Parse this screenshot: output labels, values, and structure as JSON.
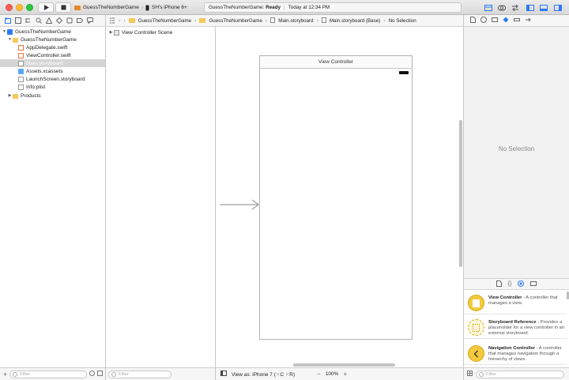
{
  "toolbar": {
    "run_icon": "play-icon",
    "stop_icon": "stop-icon",
    "scheme_name": "GuessTheNumberGame",
    "device_name": "SH's iPhone 6+",
    "status_project": "GuessTheNumberGame:",
    "status_state": "Ready",
    "status_time": "Today at 12:34 PM"
  },
  "jumpbar": {
    "crumbs": [
      "GuessTheNumberGame",
      "GuessTheNumberGame",
      "Main.storyboard",
      "Main.storyboard (Base)",
      "No Selection"
    ]
  },
  "navigator": {
    "project": "GuessTheNumberGame",
    "group": "GuessTheNumberGame",
    "files": [
      "AppDelegate.swift",
      "ViewController.swift",
      "Main.storyboard",
      "Assets.xcassets",
      "LaunchScreen.storyboard",
      "Info.plist"
    ],
    "products": "Products",
    "selected_file": "Main.storyboard"
  },
  "outline": {
    "scene": "View Controller Scene"
  },
  "canvas": {
    "vc_title": "View Controller",
    "view_as": "View as: iPhone 7 (⁙C ⁙R)",
    "zoom": "100%",
    "zoom_out": "−",
    "zoom_in": "+"
  },
  "inspector": {
    "empty_text": "No Selection"
  },
  "library": {
    "items": [
      {
        "name": "View Controller",
        "desc": "A controller that manages a view."
      },
      {
        "name": "Storyboard Reference",
        "desc": "Provides a placeholder for a view controller in an external storyboard."
      },
      {
        "name": "Navigation Controller",
        "desc": "A controller that manages navigation through a hierarchy of views."
      }
    ]
  },
  "filters": {
    "placeholder": "Filter"
  },
  "colors": {
    "folder": "#f5c95a",
    "accent_blue": "#2a7bf6",
    "library_yellow": "#f3c93e"
  }
}
